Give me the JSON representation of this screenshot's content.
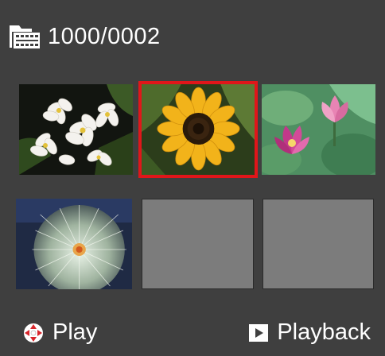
{
  "header": {
    "folder_icon": "film-folder-icon",
    "folder_number": "1000/0002"
  },
  "thumbnails": [
    {
      "subject": "white-flowers",
      "selected": false,
      "empty": false
    },
    {
      "subject": "sunflower",
      "selected": true,
      "empty": false
    },
    {
      "subject": "lotus-flowers",
      "selected": false,
      "empty": false
    },
    {
      "subject": "cactus",
      "selected": false,
      "empty": false
    },
    {
      "subject": "",
      "selected": false,
      "empty": true
    },
    {
      "subject": "",
      "selected": false,
      "empty": true
    }
  ],
  "footer": {
    "left_icon": "dpad-icon",
    "left_label": "Play",
    "right_icon": "playback-button-icon",
    "right_label": "Playback"
  },
  "colors": {
    "background": "#3f3f3f",
    "selection_border": "#e0161a",
    "empty_slot": "#7c7c7c",
    "dpad_red": "#d8252b"
  }
}
